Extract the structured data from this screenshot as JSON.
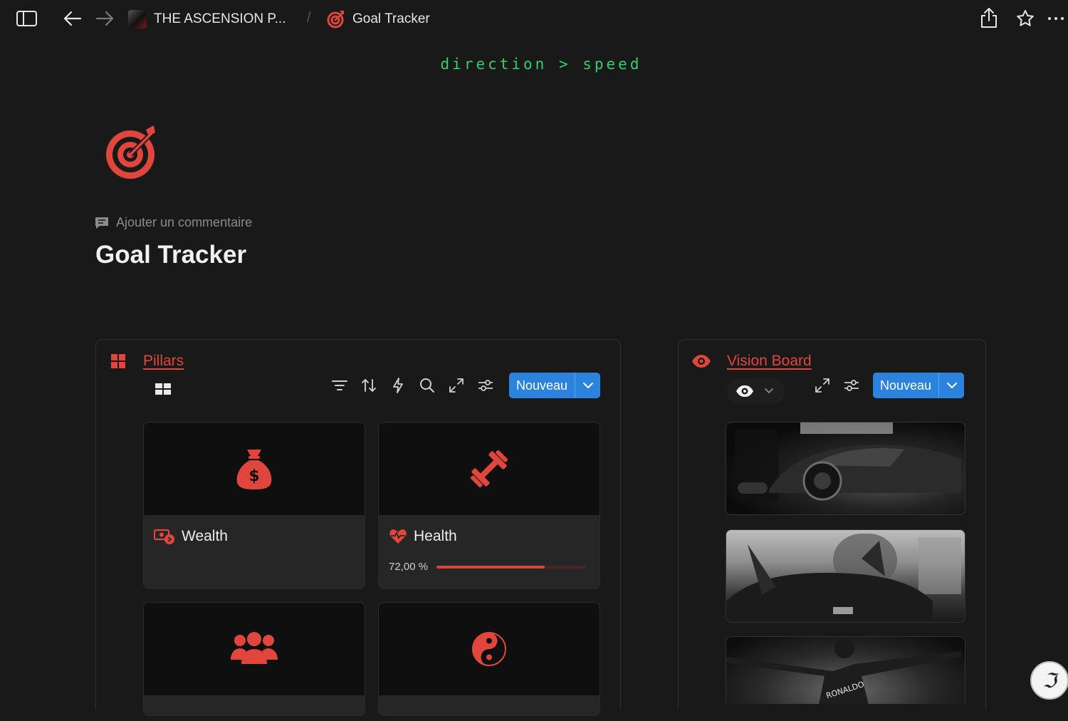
{
  "breadcrumb": {
    "parent": "THE ASCENSION P...",
    "separator": "/",
    "current": "Goal Tracker"
  },
  "tagline": "direction > speed",
  "comment_label": "Ajouter un commentaire",
  "page_title": "Goal Tracker",
  "pillars": {
    "title": "Pillars",
    "new_label": "Nouveau",
    "cards": [
      {
        "title": "Wealth",
        "cover_icon": "money-bag-icon",
        "title_icon": "money-transfer-icon"
      },
      {
        "title": "Health",
        "cover_icon": "dumbbell-icon",
        "title_icon": "heart-pulse-icon",
        "progress_text": "72,00 %",
        "progress": 0.72
      },
      {
        "title": "",
        "cover_icon": "users-icon"
      },
      {
        "title": "",
        "cover_icon": "yin-yang-icon"
      }
    ]
  },
  "vision_board": {
    "title": "Vision Board",
    "new_label": "Nouveau"
  },
  "colors": {
    "accent_red": "#e0463c",
    "tagline_green": "#33d06a",
    "button_blue": "#2b83de",
    "background": "#191919"
  }
}
